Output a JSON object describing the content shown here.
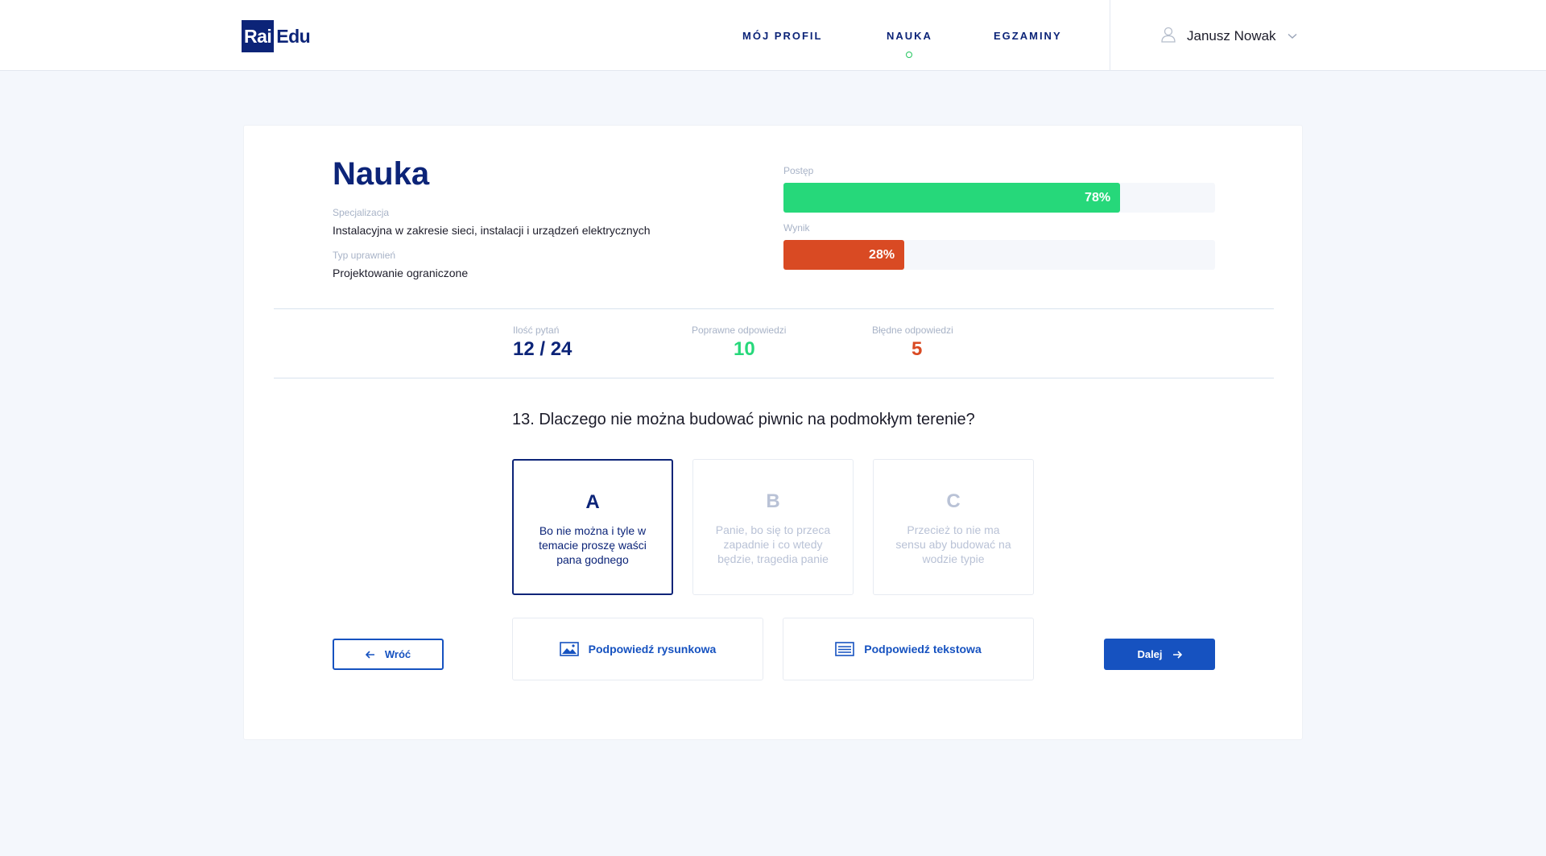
{
  "header": {
    "logo": {
      "part1": "Rai",
      "part2": "Edu"
    },
    "nav": [
      {
        "label": "MÓJ PROFIL",
        "active": false
      },
      {
        "label": "NAUKA",
        "active": true
      },
      {
        "label": "EGZAMINY",
        "active": false
      }
    ],
    "user": {
      "name": "Janusz Nowak",
      "icon": "user-icon"
    },
    "colors": {
      "brand": "#0c2478",
      "active_dot": "#22c55e"
    }
  },
  "page": {
    "title": "Nauka",
    "specialization_label": "Specjalizacja",
    "specialization_value": "Instalacyjna w zakresie sieci, instalacji i urządzeń elektrycznych",
    "permission_label": "Typ uprawnień",
    "permission_value": "Projektowanie ograniczone"
  },
  "progress": {
    "label": "Postęp",
    "percent": 78,
    "percent_text": "78%",
    "color": "#26d87a"
  },
  "score": {
    "label": "Wynik",
    "percent": 28,
    "percent_text": "28%",
    "color": "#d94a23"
  },
  "stats": {
    "questions_label": "Ilość pytań",
    "questions_value": "12 / 24",
    "correct_label": "Poprawne odpowiedzi",
    "correct_value": "10",
    "wrong_label": "Błędne odpowiedzi",
    "wrong_value": "5",
    "colors": {
      "questions": "#0c2478",
      "correct": "#26d87a",
      "wrong": "#d94a23"
    }
  },
  "question": {
    "text": "13. Dlaczego nie można budować piwnic na podmokłym terenie?",
    "answers": [
      {
        "letter": "A",
        "text": "Bo nie można i tyle w temacie proszę waści pana godnego",
        "selected": true
      },
      {
        "letter": "B",
        "text": "Panie, bo się to przeca zapadnie i co wtedy będzie, tragedia panie",
        "selected": false
      },
      {
        "letter": "C",
        "text": "Przecież to nie ma sensu aby budować na wodzie typie",
        "selected": false
      }
    ]
  },
  "actions": {
    "back_label": "Wróć",
    "next_label": "Dalej",
    "hint_image_label": "Podpowiedź rysunkowa",
    "hint_text_label": "Podpowiedź tekstowa",
    "icons": {
      "back": "arrow-left-icon",
      "next": "arrow-right-icon",
      "hint_image": "image-icon",
      "hint_text": "text-lines-icon"
    }
  }
}
